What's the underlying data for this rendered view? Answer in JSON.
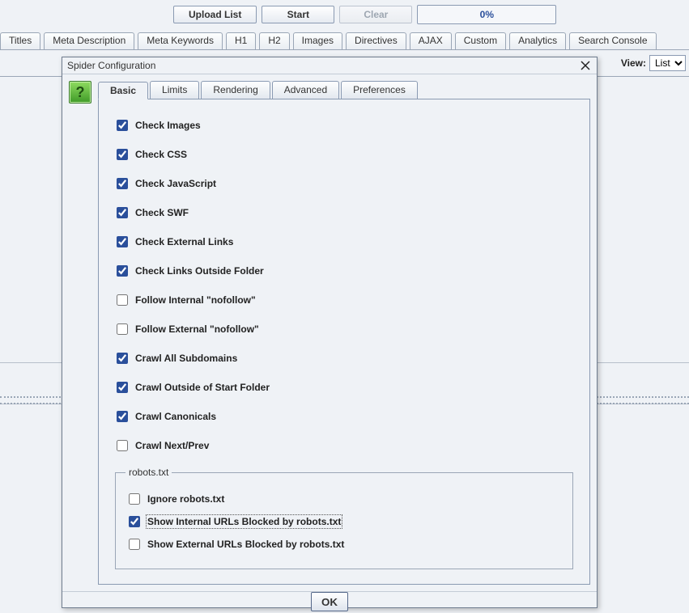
{
  "toolbar": {
    "upload_label": "Upload List",
    "start_label": "Start",
    "clear_label": "Clear",
    "progress_text": "0%"
  },
  "filter_tabs": [
    "Titles",
    "Meta Description",
    "Meta Keywords",
    "H1",
    "H2",
    "Images",
    "Directives",
    "AJAX",
    "Custom",
    "Analytics",
    "Search Console"
  ],
  "view": {
    "label": "View:",
    "selected": "List"
  },
  "dialog": {
    "title": "Spider Configuration",
    "help_glyph": "?",
    "tabs": [
      "Basic",
      "Limits",
      "Rendering",
      "Advanced",
      "Preferences"
    ],
    "active_tab": "Basic",
    "options": [
      {
        "id": "check_images",
        "label": "Check Images",
        "checked": true
      },
      {
        "id": "check_css",
        "label": "Check CSS",
        "checked": true
      },
      {
        "id": "check_js",
        "label": "Check JavaScript",
        "checked": true
      },
      {
        "id": "check_swf",
        "label": "Check SWF",
        "checked": true
      },
      {
        "id": "check_ext_links",
        "label": "Check External Links",
        "checked": true
      },
      {
        "id": "check_links_outside",
        "label": "Check Links Outside Folder",
        "checked": true
      },
      {
        "id": "follow_int_nofollow",
        "label": "Follow Internal \"nofollow\"",
        "checked": false
      },
      {
        "id": "follow_ext_nofollow",
        "label": "Follow External \"nofollow\"",
        "checked": false
      },
      {
        "id": "crawl_subdomains",
        "label": "Crawl All Subdomains",
        "checked": true
      },
      {
        "id": "crawl_outside_start",
        "label": "Crawl Outside of Start Folder",
        "checked": true
      },
      {
        "id": "crawl_canonicals",
        "label": "Crawl Canonicals",
        "checked": true
      },
      {
        "id": "crawl_next_prev",
        "label": "Crawl Next/Prev",
        "checked": false
      }
    ],
    "robots": {
      "legend": "robots.txt",
      "options": [
        {
          "id": "ignore_robots",
          "label": "Ignore robots.txt",
          "checked": false
        },
        {
          "id": "show_int_blocked",
          "label": "Show Internal URLs Blocked by robots.txt",
          "checked": true,
          "focused": true
        },
        {
          "id": "show_ext_blocked",
          "label": "Show External URLs Blocked by robots.txt",
          "checked": false
        }
      ]
    },
    "ok_label": "OK"
  }
}
